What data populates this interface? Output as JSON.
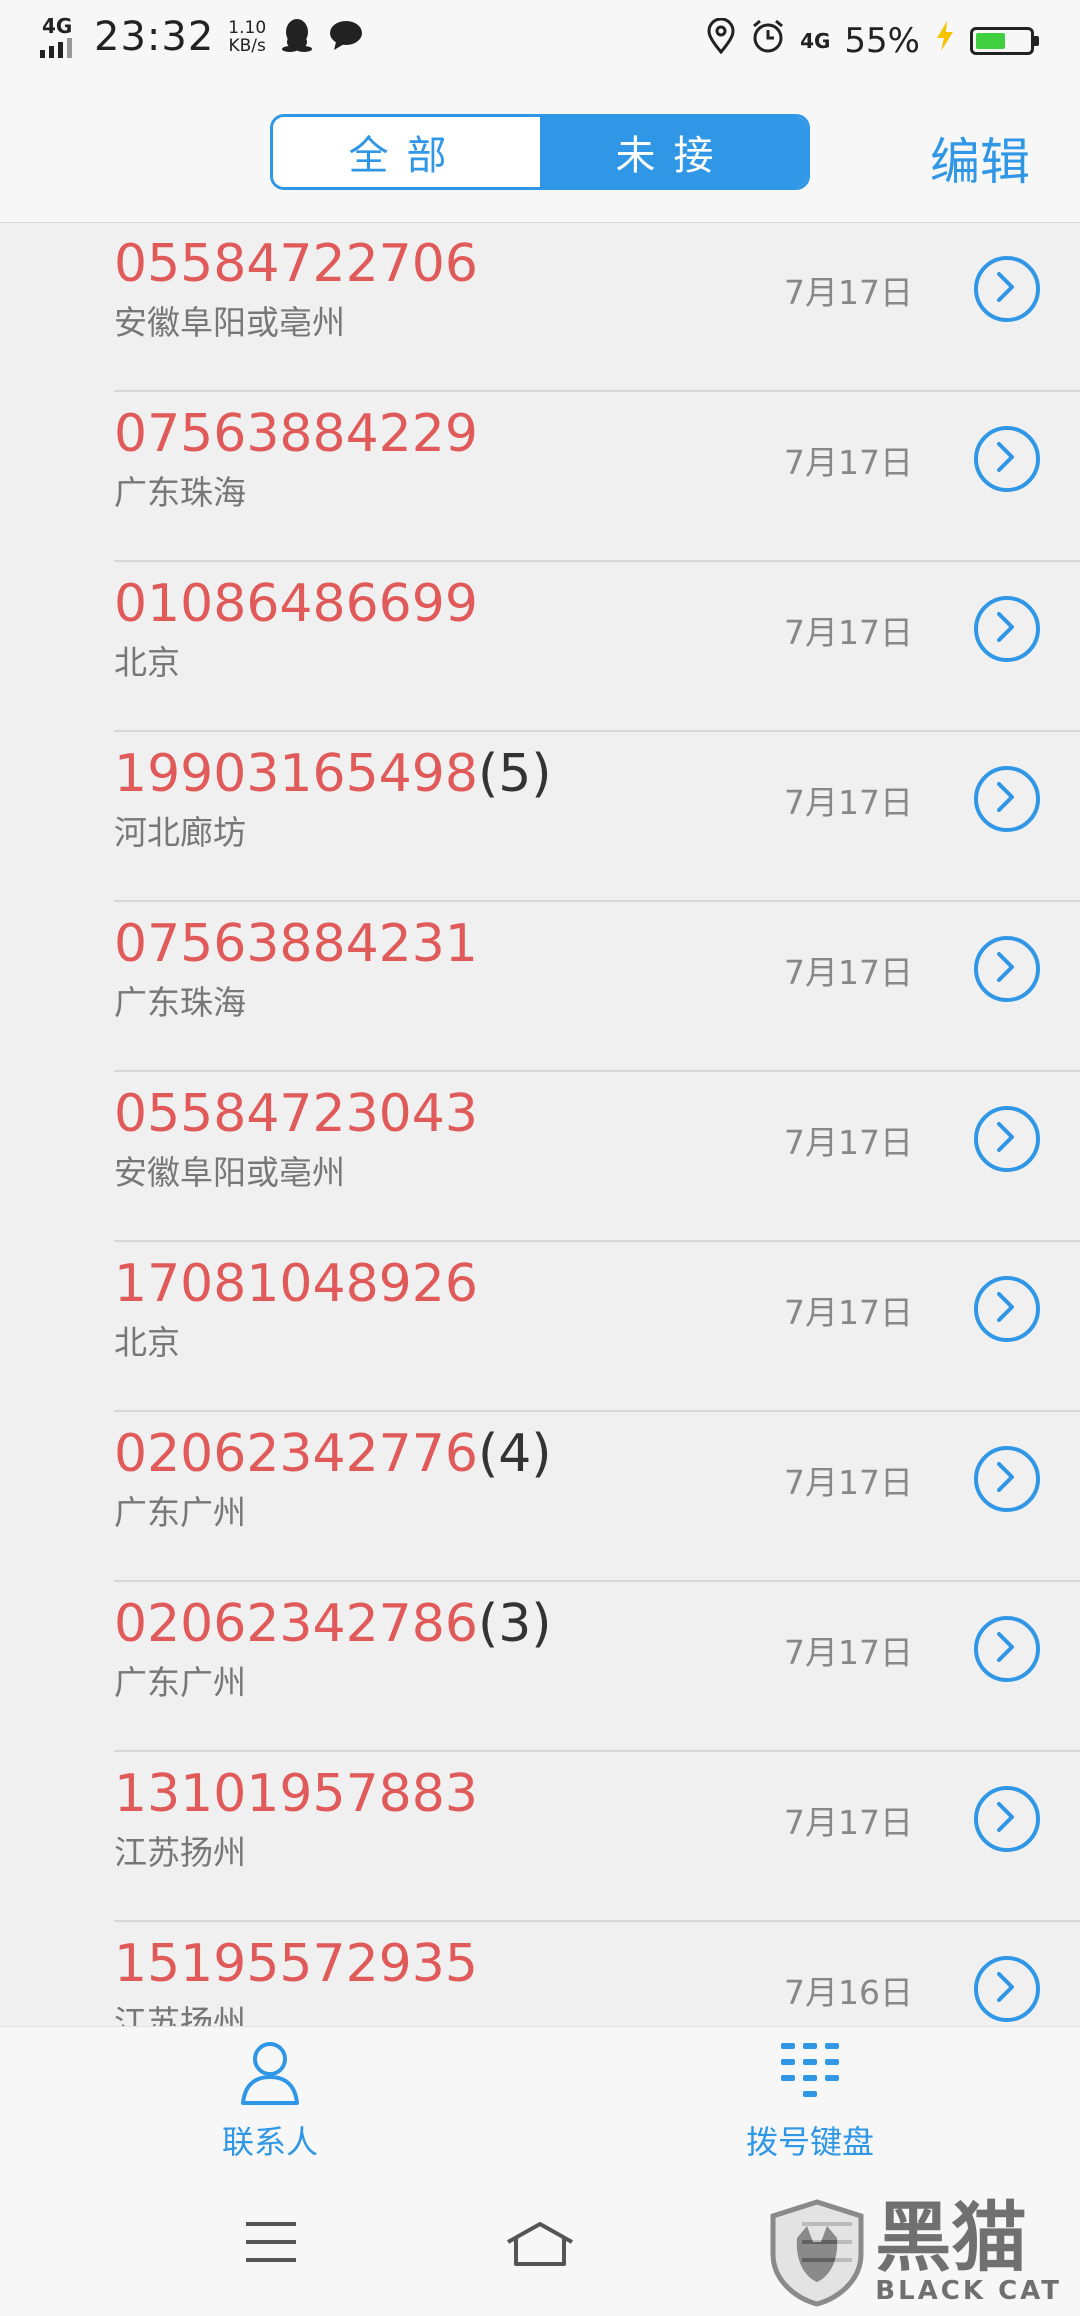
{
  "status_bar": {
    "network": "4G",
    "time": "23:32",
    "speed_value": "1.10",
    "speed_unit": "KB/s",
    "right_network": "4G",
    "battery": "55%",
    "battery_level": 0.55,
    "battery_fill_color": "#3fcf3f"
  },
  "header": {
    "tabs": [
      {
        "label": "全部",
        "active": false
      },
      {
        "label": "未接",
        "active": true
      }
    ],
    "edit_label": "编辑"
  },
  "calls": [
    {
      "number": "05584722706",
      "count": "",
      "location": "安徽阜阳或亳州",
      "date": "7月17日"
    },
    {
      "number": "07563884229",
      "count": "",
      "location": "广东珠海",
      "date": "7月17日"
    },
    {
      "number": "01086486699",
      "count": "",
      "location": "北京",
      "date": "7月17日"
    },
    {
      "number": "19903165498",
      "count": "(5)",
      "location": "河北廊坊",
      "date": "7月17日"
    },
    {
      "number": "07563884231",
      "count": "",
      "location": "广东珠海",
      "date": "7月17日"
    },
    {
      "number": "05584723043",
      "count": "",
      "location": "安徽阜阳或亳州",
      "date": "7月17日"
    },
    {
      "number": "17081048926",
      "count": "",
      "location": "北京",
      "date": "7月17日"
    },
    {
      "number": "02062342776",
      "count": "(4)",
      "location": "广东广州",
      "date": "7月17日"
    },
    {
      "number": "02062342786",
      "count": "(3)",
      "location": "广东广州",
      "date": "7月17日"
    },
    {
      "number": "13101957883",
      "count": "",
      "location": "江苏扬州",
      "date": "7月17日"
    },
    {
      "number": "15195572935",
      "count": "",
      "location": "江苏扬州",
      "date": "7月16日"
    }
  ],
  "bottom_nav": {
    "contacts_label": "联系人",
    "dialpad_label": "拨号键盘"
  },
  "watermark": {
    "cn": "黑猫",
    "en": "BLACK CAT"
  },
  "colors": {
    "accent": "#2f97e6",
    "missed_number": "#e05a5a"
  }
}
